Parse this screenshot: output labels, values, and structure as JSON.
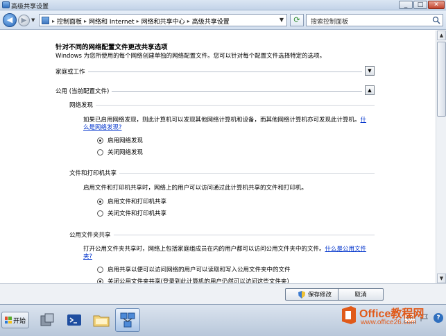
{
  "window": {
    "title": "高级共享设置",
    "minimize": "_",
    "maximize": "□",
    "close": "✕"
  },
  "address": {
    "crumbs": [
      "控制面板",
      "网络和 Internet",
      "网络和共享中心",
      "高级共享设置"
    ],
    "search_placeholder": "搜索控制面板"
  },
  "content": {
    "heading": "针对不同的网络配置文件更改共享选项",
    "intro": "Windows 为您所使用的每个网络创建单独的网络配置文件。您可以针对每个配置文件选择特定的选项。",
    "profiles": [
      {
        "label": "家庭或工作",
        "toggle": "▼"
      },
      {
        "label": "公用 (当前配置文件)",
        "toggle": "▲"
      }
    ],
    "network_discovery": {
      "title": "网络发现",
      "desc": "如果已启用网络发现，则此计算机可以发现其他网络计算机和设备，而其他网络计算机亦可发现此计算机。",
      "link": "什么是网络发现?",
      "options": [
        "启用网络发现",
        "关闭网络发现"
      ],
      "selected": 0
    },
    "file_printer": {
      "title": "文件和打印机共享",
      "desc": "启用文件和打印机共享时，网络上的用户可以访问通过此计算机共享的文件和打印机。",
      "options": [
        "启用文件和打印机共享",
        "关闭文件和打印机共享"
      ],
      "selected": 0
    },
    "public_folder": {
      "title": "公用文件夹共享",
      "desc": "打开公用文件夹共享时，网络上包括家庭组成员在内的用户都可以访问公用文件夹中的文件。",
      "link": "什么是公用文件夹?",
      "options": [
        "启用共享以便可以访问网络的用户可以读取和写入公用文件夹中的文件",
        "关闭公用文件夹共享(登录到此计算机的用户仍然可以访问这些文件夹)"
      ],
      "selected": 1
    }
  },
  "buttons": {
    "save": "保存修改",
    "cancel": "取消"
  },
  "taskbar": {
    "start": "开始",
    "ime": "CH",
    "help": "?"
  },
  "watermark": {
    "brand": "Office教程网",
    "url": "www.office26.com"
  }
}
